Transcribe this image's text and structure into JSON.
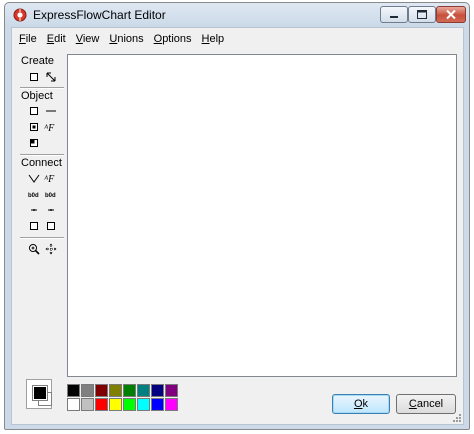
{
  "window": {
    "title": "ExpressFlowChart Editor",
    "icons": {
      "app": "flowchart-app-icon",
      "minimize": "minimize-icon",
      "maximize": "maximize-icon",
      "close": "close-icon"
    }
  },
  "menu": [
    {
      "key": "F",
      "rest": "ile"
    },
    {
      "key": "E",
      "rest": "dit"
    },
    {
      "key": "V",
      "rest": "iew"
    },
    {
      "key": "U",
      "rest": "nions"
    },
    {
      "key": "O",
      "rest": "ptions"
    },
    {
      "key": "H",
      "rest": "elp"
    }
  ],
  "toolbox": {
    "create": {
      "label": "Create",
      "tools": [
        "create-object-tool-icon",
        "create-connection-tool-icon"
      ]
    },
    "object": {
      "label": "Object",
      "tools": [
        "rectangle-shape-icon",
        "line-icon",
        "shape-image-icon",
        "font-icon",
        "fill-color-icon"
      ]
    },
    "connect": {
      "label": "Connect",
      "tools": [
        "connection-style-icon",
        "connection-font-icon",
        "source-arrow-icon",
        "dest-arrow-icon",
        "source-point-icon",
        "dest-point-icon",
        "source-shape-icon",
        "dest-shape-icon"
      ]
    },
    "view": {
      "tools": [
        "zoom-icon",
        "pan-icon"
      ]
    }
  },
  "colors": {
    "foreground": "#000000",
    "background": "#ffffff",
    "palette": [
      "#000000",
      "#808080",
      "#800000",
      "#808000",
      "#008000",
      "#008080",
      "#000080",
      "#800080",
      "#ffffff",
      "#c0c0c0",
      "#ff0000",
      "#ffff00",
      "#00ff00",
      "#00ffff",
      "#0000ff",
      "#ff00ff"
    ]
  },
  "buttons": {
    "ok": {
      "key": "O",
      "rest": "k"
    },
    "cancel": {
      "key": "C",
      "rest": "ancel"
    }
  }
}
